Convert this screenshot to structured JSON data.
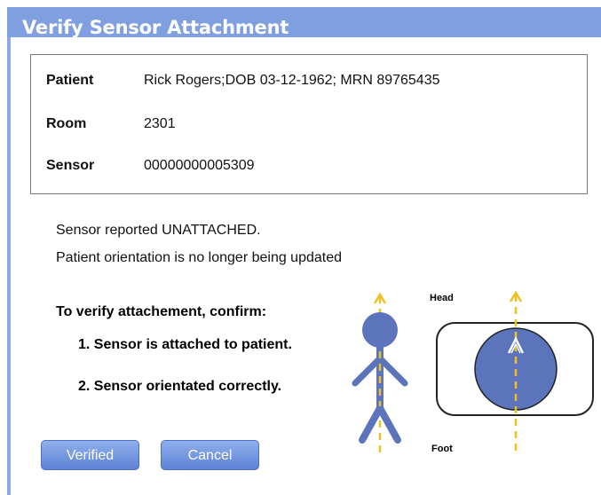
{
  "dialog": {
    "title": "Verify Sensor Attachment"
  },
  "info": {
    "patient_label": "Patient",
    "patient_value": "Rick Rogers;DOB 03-12-1962; MRN 89765435",
    "room_label": "Room",
    "room_value": "2301",
    "sensor_label": "Sensor",
    "sensor_value": "00000000005309"
  },
  "status": {
    "line1": "Sensor reported UNATTACHED.",
    "line2": "Patient orientation is no longer being updated"
  },
  "instructions": {
    "heading": "To verify attachement, confirm:",
    "step1": "1. Sensor is attached to patient.",
    "step2": "2. Sensor orientated correctly."
  },
  "diagram": {
    "head_label": "Head",
    "foot_label": "Foot"
  },
  "buttons": {
    "verified": "Verified",
    "cancel": "Cancel"
  },
  "colors": {
    "title_bar": "#7f9fe0",
    "figure_fill": "#5b74bc",
    "arrow": "#f0c020",
    "button": "#6f93e0"
  }
}
